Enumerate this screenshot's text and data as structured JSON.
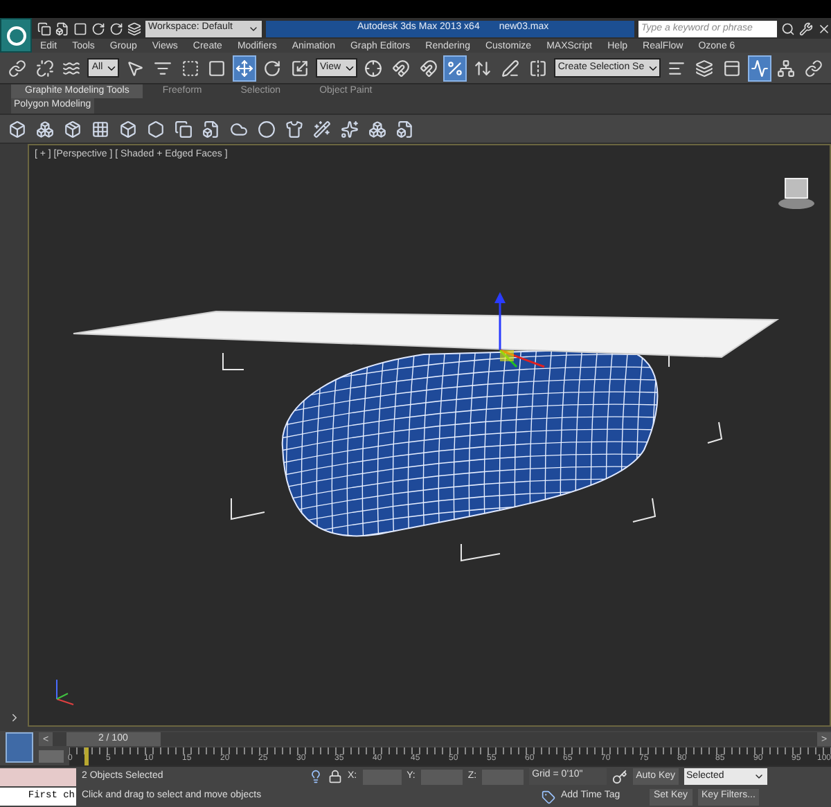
{
  "title_bar": {
    "workspace": "Workspace: Default",
    "title": "Autodesk 3ds Max 2013 x64",
    "file": "new03.max",
    "search": {
      "placeholder": "Type a keyword or phrase"
    }
  },
  "menu": [
    "Edit",
    "Tools",
    "Group",
    "Views",
    "Create",
    "Modifiers",
    "Animation",
    "Graph Editors",
    "Rendering",
    "Customize",
    "MAXScript",
    "Help",
    "RealFlow",
    "Ozone 6"
  ],
  "main_toolbar": [
    {
      "kind": "icon",
      "selected": false
    },
    {
      "kind": "icon",
      "selected": false
    },
    {
      "kind": "icon",
      "selected": false
    },
    {
      "kind": "dropdown",
      "value": "All"
    },
    {
      "kind": "icon",
      "selected": false
    },
    {
      "kind": "icon",
      "selected": false
    },
    {
      "kind": "icon",
      "selected": false
    },
    {
      "kind": "icon",
      "selected": false
    },
    {
      "kind": "icon",
      "selected": true
    },
    {
      "kind": "icon",
      "selected": false
    },
    {
      "kind": "icon",
      "selected": false
    },
    {
      "kind": "dropdown",
      "value": "View"
    },
    {
      "kind": "icon",
      "selected": false
    },
    {
      "kind": "icon",
      "selected": false
    },
    {
      "kind": "icon",
      "selected": false
    },
    {
      "kind": "icon",
      "selected": true
    },
    {
      "kind": "icon",
      "selected": false
    },
    {
      "kind": "icon",
      "selected": false
    },
    {
      "kind": "icon",
      "selected": false
    },
    {
      "kind": "dropdown",
      "value": "Create Selection Se"
    },
    {
      "kind": "icon",
      "selected": false
    },
    {
      "kind": "icon",
      "selected": false
    },
    {
      "kind": "icon",
      "selected": false
    },
    {
      "kind": "icon",
      "selected": true
    },
    {
      "kind": "icon",
      "selected": false
    },
    {
      "kind": "icon",
      "selected": false
    }
  ],
  "ribbon": {
    "tabs": [
      {
        "label": "Graphite Modeling Tools",
        "selected": true
      },
      {
        "label": "Freeform",
        "selected": false
      },
      {
        "label": "Selection",
        "selected": false
      },
      {
        "label": "Object Paint",
        "selected": false
      }
    ],
    "panel": "Polygon Modeling"
  },
  "viewport": {
    "label": "[ + ] [Perspective ] [ Shaded + Edged Faces ]"
  },
  "timeline": {
    "frame": "2 / 100",
    "level": 0.02,
    "prev": "<",
    "next": ">",
    "ticks": [
      "0",
      "5",
      "10",
      "15",
      "20",
      "25",
      "30",
      "35",
      "40",
      "45",
      "50",
      "55",
      "60",
      "65",
      "70",
      "75",
      "80",
      "85",
      "90",
      "95",
      "100"
    ]
  },
  "status": {
    "listener_input": "First ch",
    "selection": "2 Objects Selected",
    "prompt": "Click and drag to select and move objects",
    "x_label": "X:",
    "y_label": "Y:",
    "z_label": "Z:",
    "grid": "Grid = 0'10\"",
    "add_time_tag": "Add Time Tag",
    "auto_key": "Auto Key",
    "selected_dropdown": "Selected",
    "set_key": "Set Key",
    "key_filters": "Key Filters..."
  }
}
